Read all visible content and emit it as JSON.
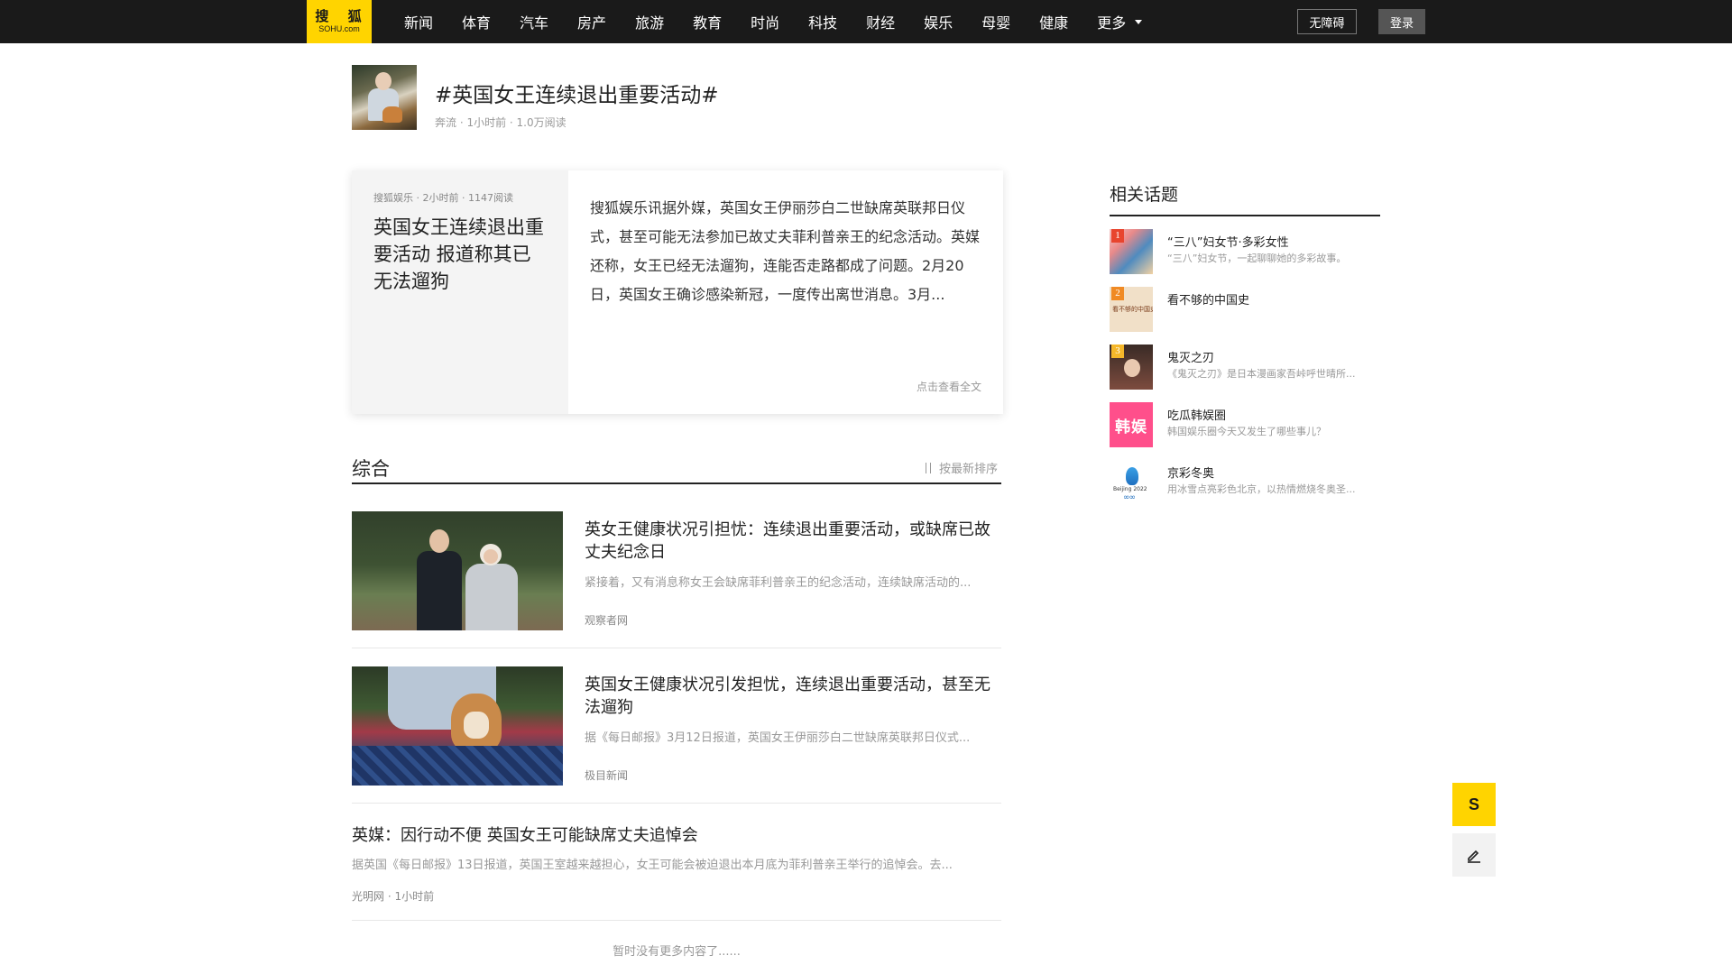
{
  "nav": {
    "logo_cn": "搜 狐",
    "logo_en": "SOHU.com",
    "items": [
      "新闻",
      "体育",
      "汽车",
      "房产",
      "旅游",
      "教育",
      "时尚",
      "科技",
      "财经",
      "娱乐",
      "母婴",
      "健康"
    ],
    "more": "更多",
    "accessibility": "无障碍",
    "login": "登录"
  },
  "topic": {
    "title": "#英国女王连续退出重要活动#",
    "meta": "奔流 · 1小时前 · 1.0万阅读"
  },
  "feature": {
    "meta": "搜狐娱乐 · 2小时前 · 1147阅读",
    "title": "英国女王连续退出重要活动 报道称其已无法遛狗",
    "summary": "搜狐娱乐讯据外媒，英国女王伊丽莎白二世缺席英联邦日仪式，甚至可能无法参加已故丈夫菲利普亲王的纪念活动。英媒还称，女王已经无法遛狗，连能否走路都成了问题。2月20日，英国女王确诊感染新冠，一度传出离世消息。3月...",
    "link": "点击查看全文"
  },
  "section": {
    "title": "综合",
    "sort": "按最新排序"
  },
  "articles": [
    {
      "title": "英女王健康状况引担忧：连续退出重要活动，或缺席已故丈夫纪念日",
      "desc": "紧接着，又有消息称女王会缺席菲利普亲王的纪念活动，连续缺席活动的...",
      "source": "观察者网"
    },
    {
      "title": "英国女王健康状况引发担忧，连续退出重要活动，甚至无法遛狗",
      "desc": "据《每日邮报》3月12日报道，英国女王伊丽莎白二世缺席英联邦日仪式...",
      "source": "极目新闻"
    },
    {
      "title": "英媒：因行动不便 英国女王可能缺席丈夫追悼会",
      "desc": "据英国《每日邮报》13日报道，英国王室越来越担心，女王可能会被迫退出本月底为菲利普亲王举行的追悼会。去...",
      "source": "光明网 · 1小时前"
    }
  ],
  "no_more": "暂时没有更多内容了......",
  "sidebar": {
    "title": "相关话题",
    "items": [
      {
        "rank": "1",
        "name": "“三八”妇女节·多彩女性",
        "desc": "“三八”妇女节，一起聊聊她的多彩故事。",
        "rank_color": "#e8452e"
      },
      {
        "rank": "2",
        "name": "看不够的中国史",
        "desc": "",
        "rank_color": "#f08a24",
        "thumb_text": "看不够的中国史"
      },
      {
        "rank": "3",
        "name": "鬼灭之刃",
        "desc": "《鬼灭之刃》是日本漫画家吾峠呼世晴所...",
        "rank_color": "#f5b72a"
      },
      {
        "rank": "",
        "name": "吃瓜韩娱圈",
        "desc": "韩国娱乐圈今天又发生了哪些事儿？",
        "thumb_text": "韩娱"
      },
      {
        "rank": "",
        "name": "京彩冬奥",
        "desc": "用冰雪点亮彩色北京，以热情燃烧冬奥圣...",
        "thumb_text": "Beijing 2022"
      }
    ]
  },
  "floating": {
    "sohu_s": "S"
  },
  "colors": {
    "brand_yellow": "#ffd400",
    "topbar": "#1a1a1a"
  }
}
